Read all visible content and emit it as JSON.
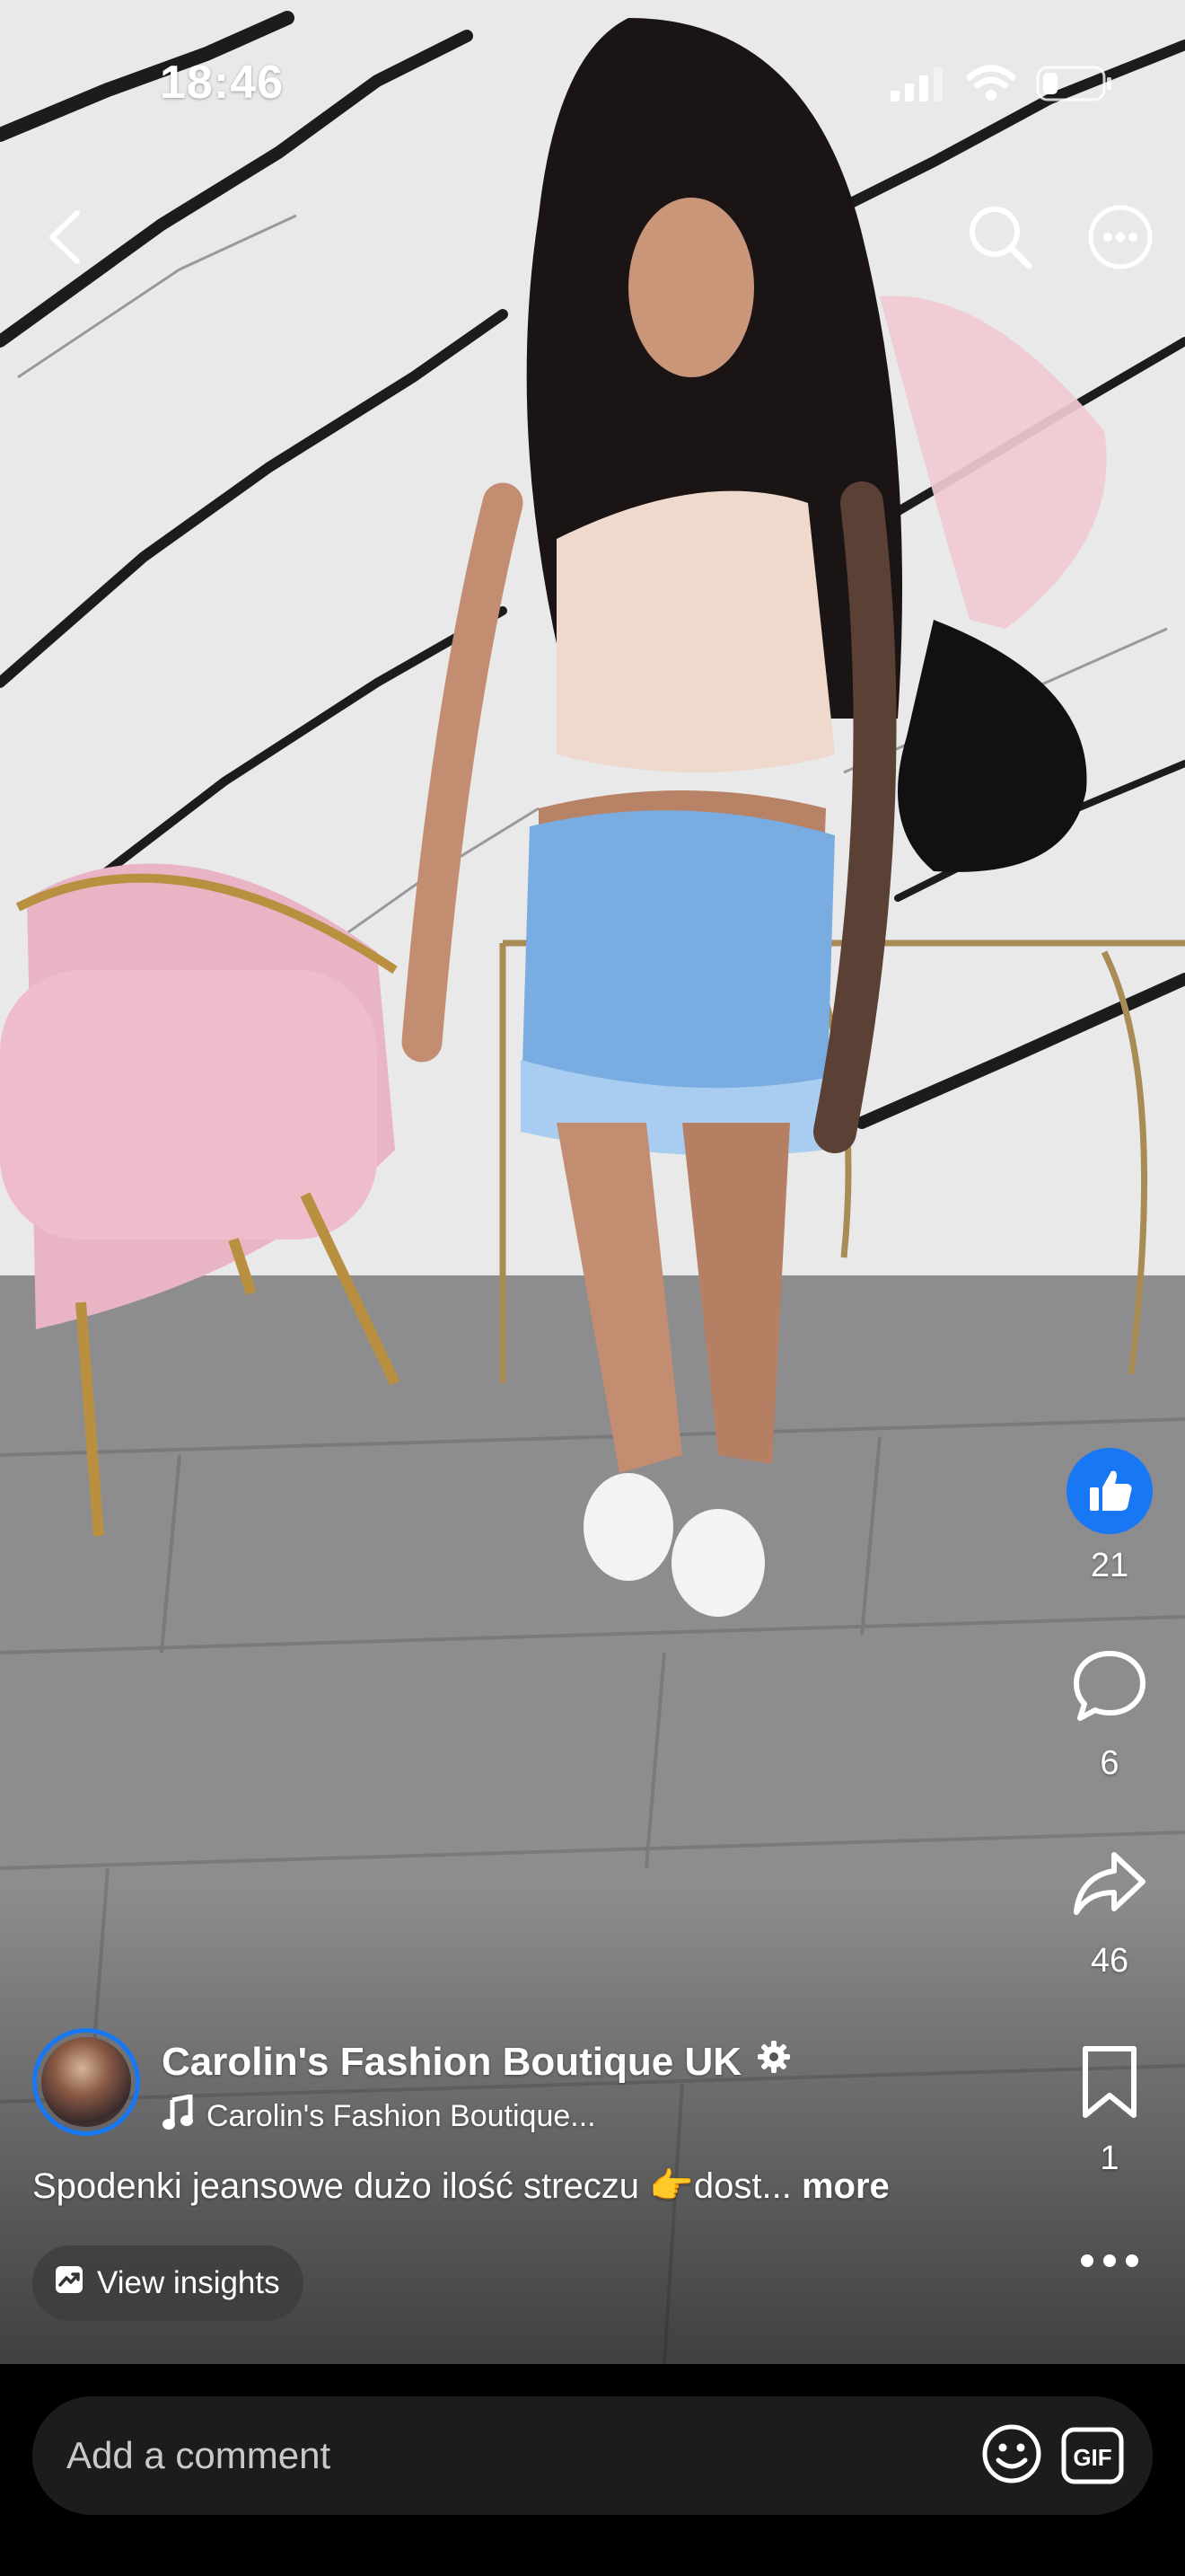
{
  "status_bar": {
    "time": "18:46",
    "icons": [
      "signal-icon",
      "wifi-icon",
      "battery-icon"
    ]
  },
  "top_nav": {
    "icons": [
      "back-icon",
      "search-icon",
      "more-options-icon"
    ]
  },
  "actions": {
    "like_count": "21",
    "comment_count": "6",
    "share_count": "46",
    "save_count": "1",
    "like_color": "#1877f2"
  },
  "post": {
    "author": "Carolin's Fashion Boutique UK",
    "audio": "Carolin's Fashion Boutique...",
    "caption": "Spodenki jeansowe dużo ilość streczu 👉dost...",
    "more_label": "more",
    "insights_label": "View insights"
  },
  "comment": {
    "placeholder": "Add a comment",
    "gif_label": "GIF"
  }
}
